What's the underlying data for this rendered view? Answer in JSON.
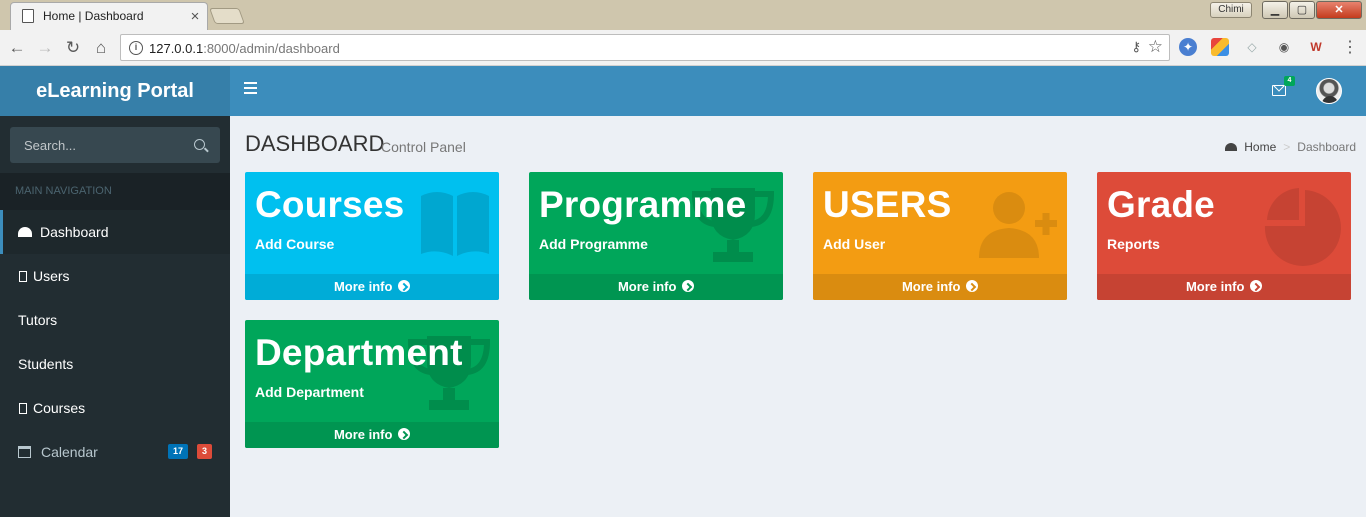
{
  "browser": {
    "tab_title": "Home | Dashboard",
    "tab_close": "×",
    "profile_name": "Chimi",
    "url_host": "127.0.0.1",
    "url_rest": ":8000/admin/dashboard",
    "win_min": "▁",
    "win_max": "▢",
    "win_close": "✕"
  },
  "app": {
    "brand": "eLearning Portal",
    "messages_count": "4"
  },
  "sidebar": {
    "search_placeholder": "Search...",
    "nav_header": "MAIN NAVIGATION",
    "items": [
      {
        "label": "Dashboard",
        "icon": "dashboard-icon",
        "active": true
      },
      {
        "label": "Users",
        "icon": "missing-glyph-icon"
      },
      {
        "label": "Tutors"
      },
      {
        "label": "Students"
      },
      {
        "label": "Courses",
        "icon": "missing-glyph-icon"
      },
      {
        "label": "Calendar",
        "icon": "calendar-icon",
        "badges": [
          "17",
          "3"
        ]
      }
    ],
    "badge_colors": [
      "#0073b7",
      "#dd4b39"
    ]
  },
  "page": {
    "title": "DASHBOARD",
    "subtitle": "Control Panel",
    "breadcrumb": [
      "Home",
      "Dashboard"
    ],
    "breadcrumb_sep": ">"
  },
  "tiles": [
    {
      "heading": "Courses",
      "sub": "Add Course",
      "footer": "More info",
      "color": "#00c0ef",
      "icon": "book-icon"
    },
    {
      "heading": "Programme",
      "sub": "Add Programme",
      "footer": "More info",
      "color": "#00a65a",
      "icon": "trophy-icon"
    },
    {
      "heading": "USERS",
      "sub": "Add User",
      "footer": "More info",
      "color": "#f39c12",
      "icon": "user-plus-icon"
    },
    {
      "heading": "Grade",
      "sub": "Reports",
      "footer": "More info",
      "color": "#dd4b39",
      "icon": "pie-chart-icon"
    },
    {
      "heading": "Department",
      "sub": "Add Department",
      "footer": "More info",
      "color": "#00a65a",
      "icon": "trophy-icon"
    }
  ]
}
